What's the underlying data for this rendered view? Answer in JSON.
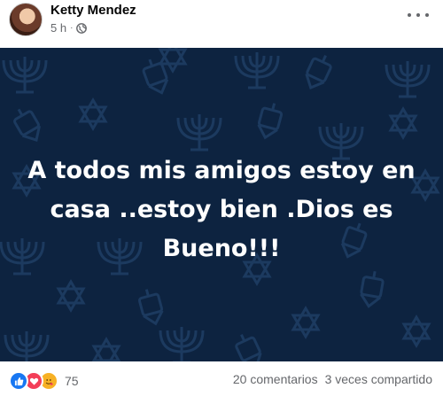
{
  "post": {
    "author": "Ketty Mendez",
    "time": "5 h",
    "separator": "·",
    "text_lines": [
      "A todos mis amigos estoy en",
      "casa ..estoy bien .Dios es",
      "Bueno!!!"
    ],
    "background_color": "#0d2340",
    "privacy_icon": "globe-icon",
    "menu_icon": "more-horizontal-icon"
  },
  "footer": {
    "reaction_icons": [
      "like-icon",
      "love-icon",
      "care-icon"
    ],
    "reaction_count": "75",
    "comments": "20 comentarios",
    "shares": "3 veces compartido"
  }
}
